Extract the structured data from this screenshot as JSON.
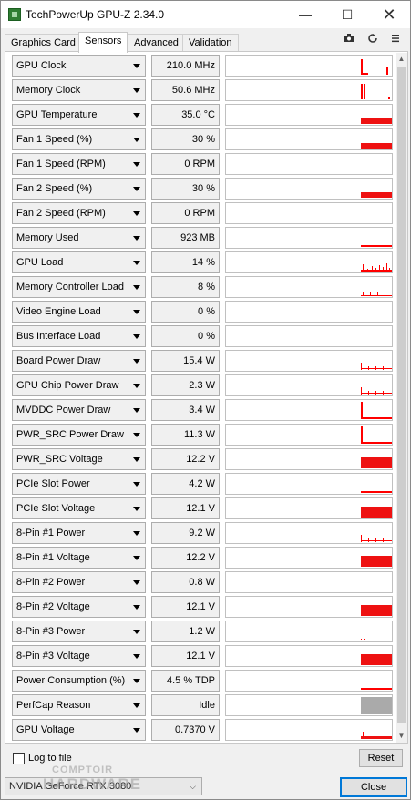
{
  "window": {
    "title": "TechPowerUp GPU-Z 2.34.0",
    "minimize_label": "—",
    "maximize_label": "☐",
    "close_label": "✕"
  },
  "tabs": [
    {
      "label": "Graphics Card",
      "active": false
    },
    {
      "label": "Sensors",
      "active": true
    },
    {
      "label": "Advanced",
      "active": false
    },
    {
      "label": "Validation",
      "active": false
    }
  ],
  "toolbar": {
    "screenshot_icon": "camera-icon",
    "refresh_icon": "refresh-icon",
    "menu_icon": "hamburger-menu-icon"
  },
  "colors": {
    "graph_line": "#ff0000",
    "graph_fill": "#ee1111",
    "perfcap_idle": "#aaaaaa",
    "focus_border": "#0078d7"
  },
  "sensors": [
    {
      "name": "GPU Clock",
      "value": "210.0 MHz",
      "graph": "spikes_high"
    },
    {
      "name": "Memory Clock",
      "value": "50.6 MHz",
      "graph": "spikes_high_sparse"
    },
    {
      "name": "GPU Temperature",
      "value": "35.0 °C",
      "graph": "band_mid"
    },
    {
      "name": "Fan 1 Speed (%)",
      "value": "30 %",
      "graph": "band_mid"
    },
    {
      "name": "Fan 1 Speed (RPM)",
      "value": "0 RPM",
      "graph": "none"
    },
    {
      "name": "Fan 2 Speed (%)",
      "value": "30 %",
      "graph": "band_mid"
    },
    {
      "name": "Fan 2 Speed (RPM)",
      "value": "0 RPM",
      "graph": "none"
    },
    {
      "name": "Memory Used",
      "value": "923 MB",
      "graph": "line_low"
    },
    {
      "name": "GPU Load",
      "value": "14 %",
      "graph": "noise_low"
    },
    {
      "name": "Memory Controller Load",
      "value": "8 %",
      "graph": "noise_tiny"
    },
    {
      "name": "Video Engine Load",
      "value": "0 %",
      "graph": "none"
    },
    {
      "name": "Bus Interface Load",
      "value": "0 %",
      "graph": "dots"
    },
    {
      "name": "Board Power Draw",
      "value": "15.4 W",
      "graph": "spike_line"
    },
    {
      "name": "GPU Chip Power Draw",
      "value": "2.3 W",
      "graph": "spike_line"
    },
    {
      "name": "MVDDC Power Draw",
      "value": "3.4 W",
      "graph": "spike_tall"
    },
    {
      "name": "PWR_SRC Power Draw",
      "value": "11.3 W",
      "graph": "spike_tall"
    },
    {
      "name": "PWR_SRC Voltage",
      "value": "12.2 V",
      "graph": "block_high"
    },
    {
      "name": "PCIe Slot Power",
      "value": "4.2 W",
      "graph": "line_low"
    },
    {
      "name": "PCIe Slot Voltage",
      "value": "12.1 V",
      "graph": "block_high"
    },
    {
      "name": "8-Pin #1 Power",
      "value": "9.2 W",
      "graph": "spike_line"
    },
    {
      "name": "8-Pin #1 Voltage",
      "value": "12.2 V",
      "graph": "block_high"
    },
    {
      "name": "8-Pin #2 Power",
      "value": "0.8 W",
      "graph": "dots"
    },
    {
      "name": "8-Pin #2 Voltage",
      "value": "12.1 V",
      "graph": "block_high"
    },
    {
      "name": "8-Pin #3 Power",
      "value": "1.2 W",
      "graph": "dots"
    },
    {
      "name": "8-Pin #3 Voltage",
      "value": "12.1 V",
      "graph": "block_high"
    },
    {
      "name": "Power Consumption (%)",
      "value": "4.5 % TDP",
      "graph": "line_low"
    },
    {
      "name": "PerfCap Reason",
      "value": "Idle",
      "graph": "gray_block"
    },
    {
      "name": "GPU Voltage",
      "value": "0.7370 V",
      "graph": "band_low"
    }
  ],
  "scrollbar": {
    "up_label": "▲",
    "down_label": "▼"
  },
  "bottom": {
    "log_label": "Log to file",
    "log_checked": false,
    "reset_label": "Reset",
    "gpu_select_value": "NVIDIA GeForce RTX 3080",
    "close_label": "Close"
  },
  "watermark": {
    "line1": "COMPTOIR",
    "line2": "HARDWARE"
  }
}
